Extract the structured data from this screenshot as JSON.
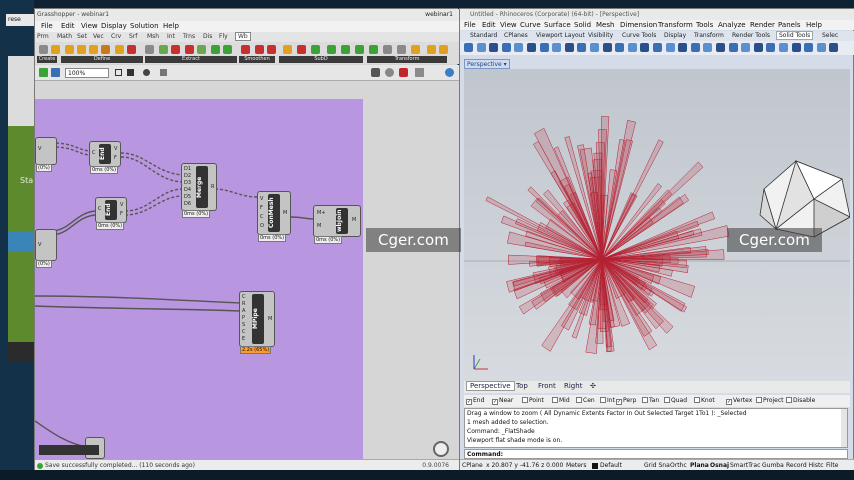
{
  "desktop": {
    "tab_label": "rese",
    "side_text": "Sta"
  },
  "grasshopper": {
    "title": "Grasshopper - webinar1",
    "file_name": "webinar1",
    "menu": [
      "File",
      "Edit",
      "View",
      "Display",
      "Solution",
      "Help"
    ],
    "tabs": [
      "Prm",
      "Math",
      "Set",
      "Vec",
      "Crv",
      "Srf",
      "Msh",
      "Int",
      "Trns",
      "Dis",
      "Fly",
      "Wb"
    ],
    "active_tab": "Wb",
    "ribbon_groups": [
      "Create",
      "Define",
      "Extract",
      "Smoothen",
      "SubD",
      "Transform"
    ],
    "zoom": "100%",
    "nodes": [
      {
        "label": "End",
        "pins_in": [
          "C"
        ],
        "pins_out": [
          "V",
          "F"
        ],
        "time": "0ms (0%)"
      },
      {
        "label": "End",
        "pins_in": [
          "C"
        ],
        "pins_out": [
          "V",
          "F"
        ],
        "time": "0ms (0%)"
      },
      {
        "label": "Merge",
        "pins_in": [
          "D1",
          "D2",
          "D3",
          "D4",
          "D5",
          "D6"
        ],
        "pins_out": [
          "R"
        ],
        "time": "0ms (0%)"
      },
      {
        "label": "ConMesh",
        "pins_in": [
          "V",
          "F",
          "C",
          "O"
        ],
        "pins_out": [
          "M"
        ],
        "time": "0ms (0%)"
      },
      {
        "label": "wbJoin",
        "pins_in": [
          "M+",
          "M"
        ],
        "pins_out": [
          "M"
        ],
        "time": "0ms (0%)"
      },
      {
        "label": "MPipe",
        "pins_in": [
          "C",
          "R",
          "A",
          "P",
          "S",
          "C",
          "E"
        ],
        "pins_out": [
          "M"
        ],
        "time": "2.2s (65%)"
      }
    ],
    "left_params": [
      {
        "label": "V",
        "time": "(0%)"
      },
      {
        "label": "V",
        "time": "(0%)"
      }
    ],
    "status": "Save successfully completed... (110 seconds ago)",
    "version": "0.9.0076"
  },
  "rhino": {
    "title": "Untitled - Rhinoceros (Corporate) (64-bit) - [Perspective]",
    "menu": [
      "File",
      "Edit",
      "View",
      "Curve",
      "Surface",
      "Solid",
      "Mesh",
      "Dimension",
      "Transform",
      "Tools",
      "Analyze",
      "Render",
      "Panels",
      "Help"
    ],
    "tabs": [
      "Standard",
      "CPlanes",
      "Viewport Layout",
      "Visibility",
      "Curve Tools",
      "Display",
      "Transform",
      "Render Tools",
      "Solid Tools",
      "Selec"
    ],
    "active_tab": "Solid Tools",
    "viewport_name": "Perspective",
    "viewport_tabs": [
      "Perspective",
      "Top",
      "Front",
      "Right"
    ],
    "osnaps": [
      {
        "label": "End",
        "checked": true
      },
      {
        "label": "Near",
        "checked": true
      },
      {
        "label": "Point",
        "checked": false
      },
      {
        "label": "Mid",
        "checked": false
      },
      {
        "label": "Cen",
        "checked": false
      },
      {
        "label": "Int",
        "checked": false
      },
      {
        "label": "Perp",
        "checked": true
      },
      {
        "label": "Tan",
        "checked": false
      },
      {
        "label": "Quad",
        "checked": false
      },
      {
        "label": "Knot",
        "checked": false
      },
      {
        "label": "Vertex",
        "checked": true
      },
      {
        "label": "Project",
        "checked": false
      },
      {
        "label": "Disable",
        "checked": false
      }
    ],
    "history": [
      "Drag a window to zoom ( All  Dynamic  Extents  Factor  In  Out  Selected  Target  1To1 ): _Selected",
      "1 mesh added to selection.",
      "Command: _FlatShade",
      "Viewport flat shade mode is on."
    ],
    "command_prompt": "Command:",
    "status": {
      "cplane": "CPlane",
      "coords": "x 20.807  y -41.76  z 0.000",
      "units": "Meters",
      "layer": "Default",
      "toggles": [
        "Grid Sna",
        "Orthc",
        "Plana",
        "Osnaj",
        "SmartTrac",
        "Gumba",
        "Record Histc",
        "Filte"
      ]
    }
  },
  "watermark": "Cger.com",
  "colors": {
    "group_bg": "#b996e0",
    "spike": "#b52233",
    "accent": "#3a85b8"
  }
}
